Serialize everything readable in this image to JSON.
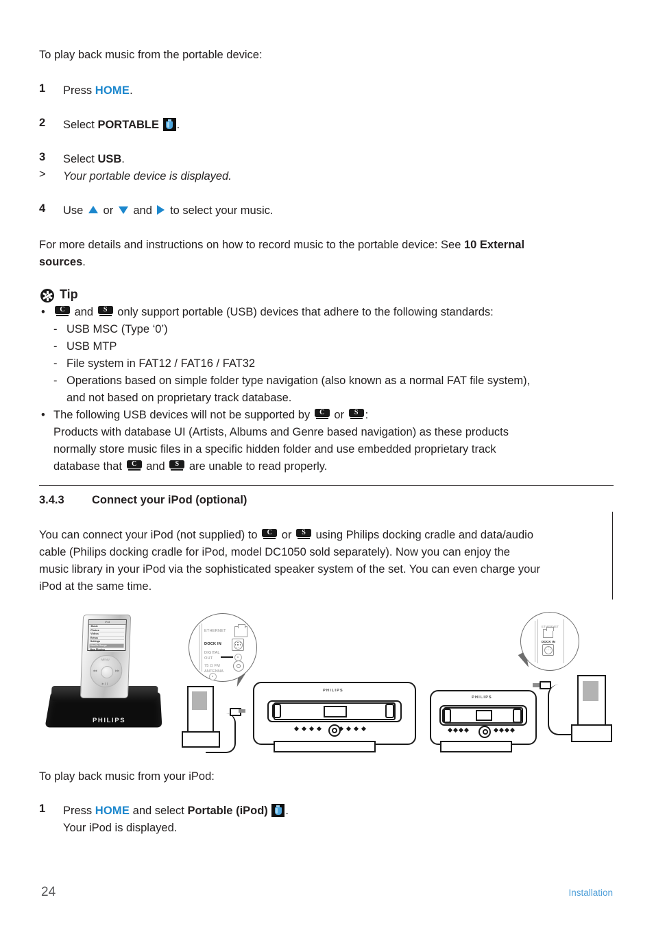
{
  "intro": {
    "text": "To play back music from the portable device:"
  },
  "steps_usb": [
    {
      "num": "1",
      "pre": "Press ",
      "bold_blue": "HOME",
      "post": "."
    },
    {
      "num": "2",
      "pre": "Select ",
      "bold": "PORTABLE",
      "icon": "usb-drive-icon",
      "post": "."
    },
    {
      "num": "3",
      "pre": "Select ",
      "bold": "USB",
      "post": "."
    },
    {
      "marker": ">",
      "italic": "Your portable device is displayed."
    },
    {
      "num": "4",
      "pre": "Use ",
      "arrows": [
        "up-arrow-icon",
        "down-arrow-icon",
        "right-arrow-icon"
      ],
      "mid1": " or ",
      "mid2": " and ",
      "post": " to select your music."
    }
  ],
  "more_details": {
    "line1_pre": "For more details and instructions on how to record music to the portable device: See ",
    "line1_bold": "10 External",
    "line2_bold": "sources",
    "line2_post": "."
  },
  "tip": {
    "label": "Tip",
    "icon": "tip-asterisk-icon",
    "bullet1": {
      "badge1": "C",
      "and": " and ",
      "badge2": "S",
      "text": " only support portable (USB) devices that adhere to the following standards:"
    },
    "sub_items": [
      "USB MSC (Type ‘0’)",
      "USB MTP",
      "File system in FAT12 / FAT16 / FAT32",
      "Operations based on simple folder type navigation (also known as a normal FAT file system),",
      "and not based on proprietary track database."
    ],
    "bullet2": {
      "pre": "The following USB devices will not be supported by ",
      "badge1": "C",
      "or": " or ",
      "badge2": "S",
      "post": ":",
      "line2": "Products with database UI (Artists, Albums and Genre based navigation) as these products",
      "line3": "normally store music files in a specific hidden folder and use embedded proprietary track",
      "line4_pre": "database that ",
      "line4_badge1": "C",
      "line4_and": " and ",
      "line4_badge2": "S",
      "line4_post": " are unable to read properly."
    }
  },
  "section": {
    "number": "3.4.3",
    "title": "Connect your iPod (optional)",
    "paragraph": {
      "l1_pre": "You can connect your iPod (not supplied) to ",
      "l1_badge1": "C",
      "l1_or": " or ",
      "l1_badge2": "S",
      "l1_post": " using Philips docking cradle and data/audio",
      "l2": "cable (Philips docking cradle for iPod, model DC1050 sold separately). Now you can enjoy the",
      "l3": "music library in your iPod via the sophisticated speaker system of the set. You can even charge your",
      "l4": "iPod at the same time."
    }
  },
  "diagram": {
    "dock_brand": "PHILIPS",
    "ipod_screen": {
      "title": "iPod",
      "menu": [
        "Music",
        "Photos",
        "Videos",
        "Extras",
        "Settings",
        "Shuffle Songs",
        "Now Playing"
      ],
      "selected": "Shuffle Songs"
    },
    "callout_left": {
      "labels": [
        "ETHERNET",
        "DOCK IN",
        "DIGITAL",
        "OUT",
        "75 Ω FM",
        "ANTENNA"
      ],
      "ports": [
        "ethernet-port-icon",
        "dock-in-port-icon",
        "digital-out-port-icon",
        "fm-antenna-port-icon"
      ]
    },
    "callout_right": {
      "labels": [
        "ETHERNET",
        "DOCK IN"
      ],
      "ports": [
        "ethernet-port-icon",
        "dock-in-port-icon"
      ]
    },
    "hifi_brand": "PHILIPS"
  },
  "outro": {
    "text": "To play back music from your iPod:"
  },
  "steps_ipod": [
    {
      "num": "1",
      "pre": "Press ",
      "bold_blue": "HOME",
      "mid": " and select ",
      "bold": "Portable (iPod)",
      "icon": "usb-drive-icon",
      "post": ".",
      "line2": "Your iPod is displayed."
    }
  ],
  "footer": {
    "page_number": "24",
    "label": "Installation"
  },
  "colors": {
    "accent_blue": "#1c87cd",
    "footer_blue": "#4f9fd8",
    "text": "#231f20"
  }
}
